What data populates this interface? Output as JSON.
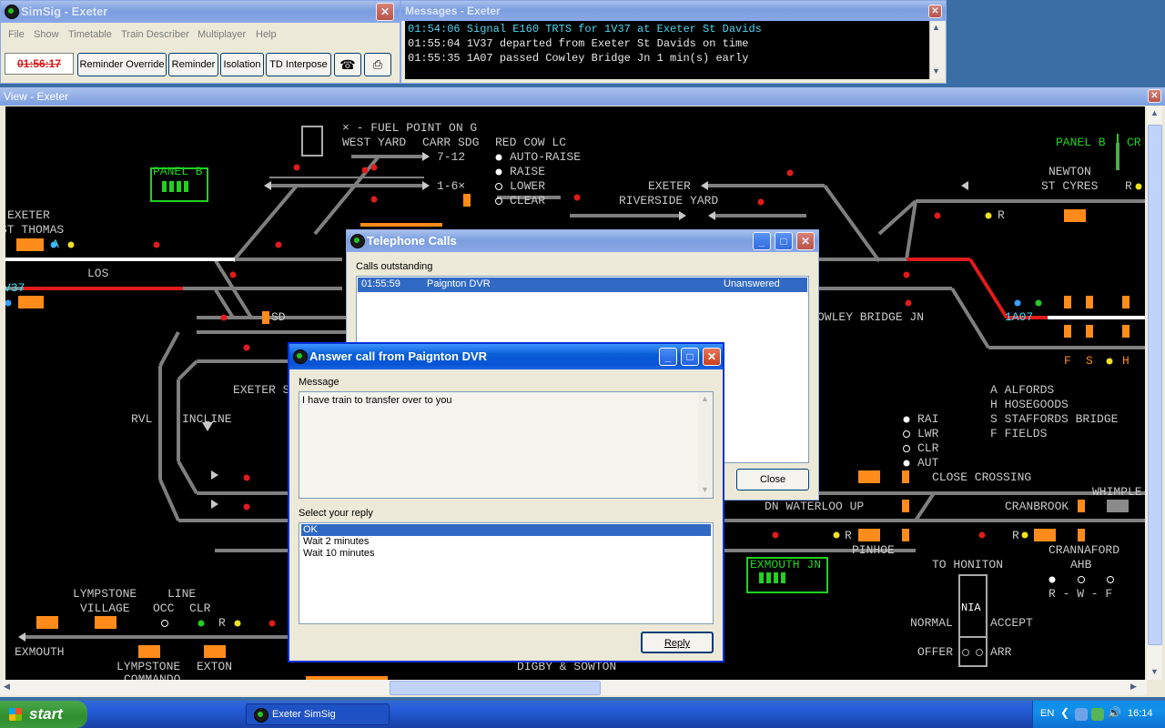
{
  "simsig_window": {
    "title": "SimSig - Exeter",
    "menu": [
      "File",
      "Show",
      "Timetable",
      "Train Describer",
      "Multiplayer",
      "Help"
    ],
    "clock": "01:56:17",
    "buttons": [
      "Reminder Override",
      "Reminder",
      "Isolation",
      "TD Interpose"
    ]
  },
  "messages_window": {
    "title": "Messages - Exeter",
    "lines": [
      "01:54:06 Signal E160 TRTS for 1V37 at Exeter St Davids",
      "01:55:04 1V37 departed from Exeter St Davids on time",
      "01:55:35 1A07 passed Cowley Bridge Jn 1 min(s) early"
    ]
  },
  "view_window": {
    "title": "View - Exeter",
    "labels": {
      "fuel": "× - FUEL POINT ON G",
      "west_yard": "WEST YARD",
      "carr_sdg": "CARR SDG",
      "sdg_712": "7-12",
      "sdg_16": "1-6×",
      "red_cow": "RED COW LC",
      "auto_raise": "AUTO-RAISE",
      "raise": "RAISE",
      "lower": "LOWER",
      "clear": "CLEAR",
      "exeter1": "EXETER",
      "riverside": "RIVERSIDE YARD",
      "panel_b_left": "PANEL B",
      "panel_b_right": "PANEL B",
      "panel_c_right": "CR",
      "newton": "NEWTON",
      "st_cyres": "ST CYRES",
      "exeter_st_thomas_1": "EXETER",
      "exeter_st_thomas_2": "ST THOMAS",
      "los": "LOS",
      "td_1v37": "V37",
      "sd": "SD",
      "exeter_s": "EXETER S",
      "rvl": "RVL",
      "incline": "INCLINE",
      "cowley": "OWLEY BRIDGE JN",
      "td_1a07": "1A07",
      "key_a": "A ALFORDS",
      "key_h": "H HOSEGOODS",
      "key_s": "S STAFFORDS BRIDGE",
      "key_f": "F FIELDS",
      "rai": "RAI",
      "lwr": "LWR",
      "clr": "CLR",
      "aut": "AUT",
      "close_crossing": "CLOSE CROSSING",
      "whimple": "WHIMPLE",
      "dn_waterloo": "DN WATERLOO UP",
      "cranbrook": "CRANBROOK",
      "pinhoe": "PINHOE",
      "exmouth_jn": "EXMOUTH JN",
      "to_honiton": "TO HONITON",
      "cannaford": "CRANNAFORD",
      "ahb": "AHB",
      "rwf": "R - W - F",
      "normal": "NORMAL",
      "accept": "ACCEPT",
      "offer": "OFFER",
      "arr": "ARR",
      "nia": "NIA",
      "lympstone1": "LYMPSTONE",
      "village": "VILLAGE",
      "line": "LINE",
      "occ": "OCC",
      "clr2": "CLR",
      "exmouth": "EXMOUTH",
      "lympstone2": "LYMPSTONE",
      "commando": "COMMANDO",
      "exton": "EXTON",
      "digby": "DIGBY & SOWTON",
      "sig_letters": [
        "A",
        "R",
        "R",
        "R",
        "R",
        "R",
        "F",
        "S",
        "H"
      ]
    }
  },
  "telephone_window": {
    "title": "Telephone Calls",
    "calls_label": "Calls outstanding",
    "calls": [
      {
        "time": "01:55:59",
        "from": "Paignton DVR",
        "status": "Unanswered"
      }
    ],
    "close_label": "Close"
  },
  "answer_dialog": {
    "title": "Answer call from Paignton DVR",
    "message_label": "Message",
    "message": "I have train  to transfer over to you",
    "reply_label": "Select your reply",
    "replies": [
      "OK",
      "Wait 2 minutes",
      "Wait 10 minutes"
    ],
    "selected_reply": "OK",
    "reply_button": "Reply"
  },
  "taskbar": {
    "start": "start",
    "task": "Exeter SimSig",
    "lang": "EN",
    "time": "16:14"
  },
  "colors": {
    "track": "#7f7f7f",
    "occupied": "#e11b1b",
    "route": "#ffffff",
    "td": "#ff8c1a",
    "xp_blue": "#0a5fd8",
    "desktop": "#3a6ea5"
  }
}
